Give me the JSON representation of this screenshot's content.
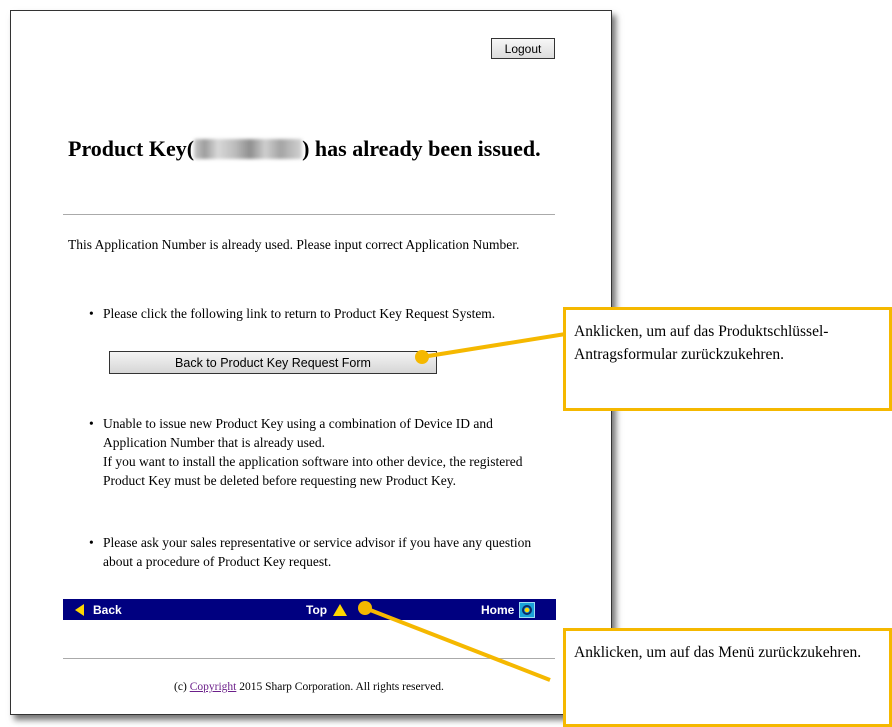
{
  "header": {
    "logout_label": "Logout"
  },
  "title": {
    "prefix": "Product Key(",
    "suffix": ") has already been issued."
  },
  "intro": "This Application Number is already used. Please input correct Application Number.",
  "bullets": {
    "one": "Please click the following link to return to Product Key Request System.",
    "two_line1": "Unable to issue new Product Key using a combination of Device ID and Application Number that is already used.",
    "two_line2": "If you want to install the application software into other device, the registered Product Key must be deleted before requesting new Product Key.",
    "three": "Please ask your sales representative or service advisor if you have any question about a procedure of Product Key request."
  },
  "back_form_button": "Back to Product Key Request Form",
  "nav": {
    "back": "Back",
    "top": "Top",
    "home": "Home"
  },
  "footer": {
    "prefix": "(c) ",
    "link": "Copyright",
    "suffix": " 2015 Sharp Corporation. All rights reserved."
  },
  "callouts": {
    "form": "Anklicken, um auf das Produktschlüssel-Antragsformular zurückzukehren.",
    "menu": "Anklicken, um auf das Menü zurückzukehren."
  },
  "colors": {
    "nav_bg": "#000080",
    "accent": "#f5b800",
    "nav_icon": "#ffd700"
  },
  "icons": {
    "back": "triangle-left-icon",
    "top": "triangle-up-icon",
    "home": "home-target-icon",
    "bullet": "bullet-dot-icon"
  }
}
